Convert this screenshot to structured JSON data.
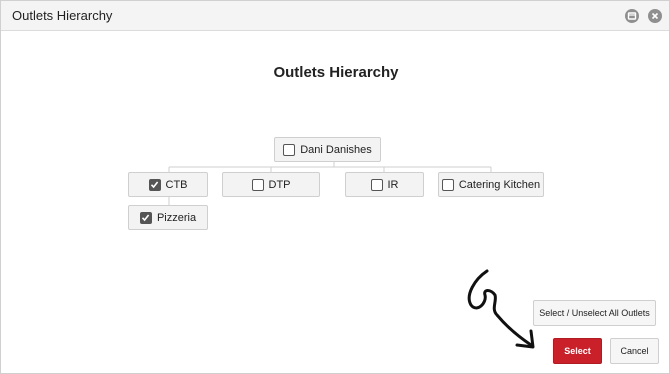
{
  "window": {
    "title": "Outlets Hierarchy"
  },
  "heading": "Outlets Hierarchy",
  "tree": {
    "root": {
      "label": "Dani Danishes",
      "checked": false
    },
    "children": [
      {
        "label": "CTB",
        "checked": true
      },
      {
        "label": "DTP",
        "checked": false
      },
      {
        "label": "IR",
        "checked": false
      },
      {
        "label": "Catering Kitchen",
        "checked": false
      }
    ],
    "grandchildren": [
      {
        "label": "Pizzeria",
        "checked": true
      }
    ]
  },
  "actions": {
    "select_all_label": "Select / Unselect All Outlets",
    "select_label": "Select",
    "cancel_label": "Cancel"
  },
  "colors": {
    "primary": "#c9202a",
    "node_bg": "#f3f3f3",
    "checkbox": "#555555"
  },
  "icons": [
    "minimize-icon",
    "close-icon",
    "checkbox-icon",
    "arrow-annotation"
  ]
}
